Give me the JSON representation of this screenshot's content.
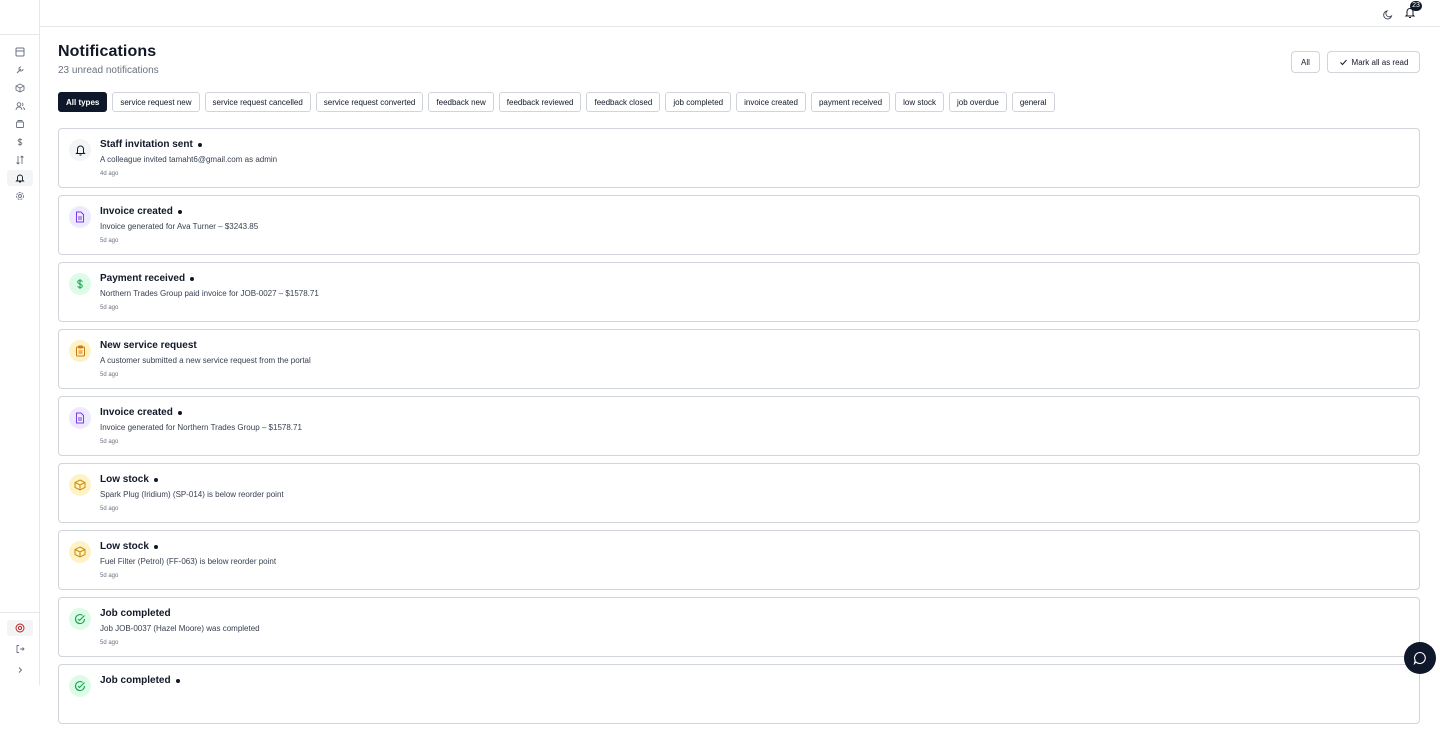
{
  "topbar": {
    "unread_badge": "23"
  },
  "header": {
    "title": "Notifications",
    "subtitle": "23 unread notifications",
    "all_button": "All",
    "mark_all_button": "Mark all as read"
  },
  "filters": [
    "All types",
    "service request new",
    "service request cancelled",
    "service request converted",
    "feedback new",
    "feedback reviewed",
    "feedback closed",
    "job completed",
    "invoice created",
    "payment received",
    "low stock",
    "job overdue",
    "general"
  ],
  "notifications": [
    {
      "title": "Staff invitation sent",
      "message": "A colleague invited tamaht6@gmail.com as admin",
      "time": "4d ago",
      "icon": "bell-icon",
      "unread": true
    },
    {
      "title": "Invoice created",
      "message": "Invoice generated for Ava Turner – $3243.85",
      "time": "5d ago",
      "icon": "document-icon",
      "unread": true
    },
    {
      "title": "Payment received",
      "message": "Northern Trades Group paid invoice for JOB-0027 – $1578.71",
      "time": "5d ago",
      "icon": "dollar-icon",
      "unread": true
    },
    {
      "title": "New service request",
      "message": "A customer submitted a new service request from the portal",
      "time": "5d ago",
      "icon": "clipboard-icon",
      "unread": false
    },
    {
      "title": "Invoice created",
      "message": "Invoice generated for Northern Trades Group – $1578.71",
      "time": "5d ago",
      "icon": "document-icon",
      "unread": true
    },
    {
      "title": "Low stock",
      "message": "Spark Plug (Iridium) (SP-014) is below reorder point",
      "time": "5d ago",
      "icon": "package-icon",
      "unread": true
    },
    {
      "title": "Low stock",
      "message": "Fuel Filter (Petrol) (FF-063) is below reorder point",
      "time": "5d ago",
      "icon": "package-icon",
      "unread": true
    },
    {
      "title": "Job completed",
      "message": "Job JOB-0037 (Hazel Moore) was completed",
      "time": "5d ago",
      "icon": "check-circle-icon",
      "unread": false
    },
    {
      "title": "Job completed",
      "message": "",
      "time": "",
      "icon": "check-circle-icon",
      "unread": true
    }
  ],
  "colors": {
    "bell-icon": "#111827",
    "document-icon": "#7c3aed",
    "dollar-icon": "#16a34a",
    "clipboard-icon": "#d97706",
    "package-icon": "#ca8a04",
    "check-circle-icon": "#16a34a",
    "bell-bg": "#f3f4f6",
    "document-bg": "#ede9fe",
    "dollar-bg": "#dcfce7",
    "clipboard-bg": "#fef3c7",
    "package-bg": "#fef3c7",
    "check-bg": "#dcfce7"
  }
}
